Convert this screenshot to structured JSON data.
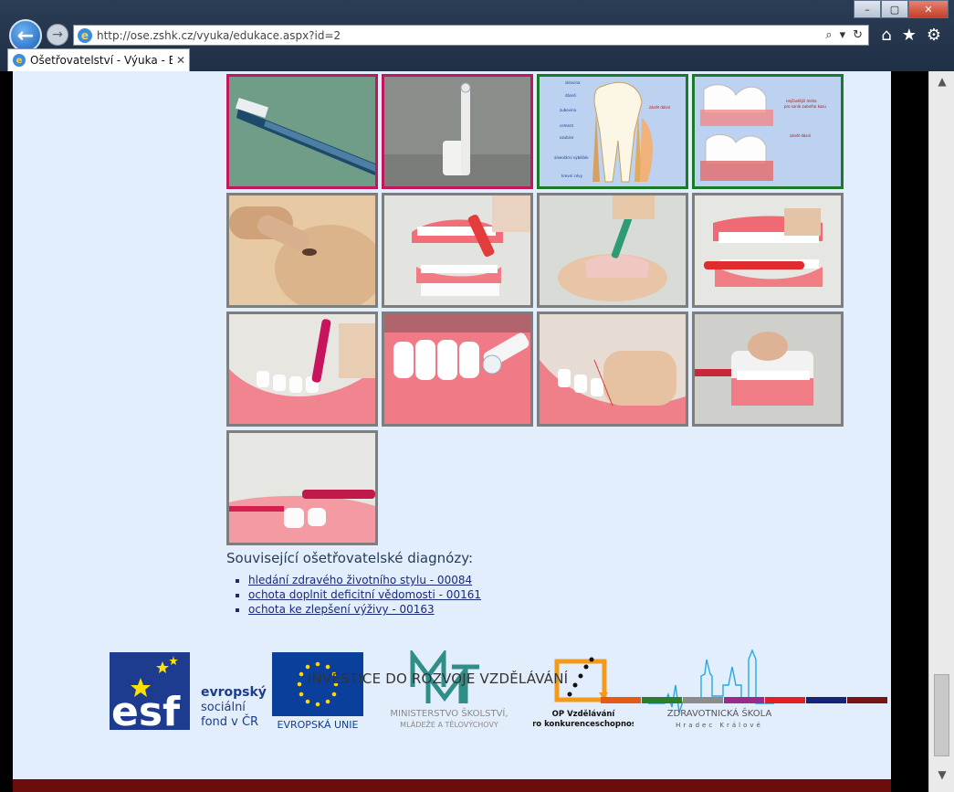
{
  "browser": {
    "url": "http://ose.zshk.cz/vyuka/edukace.aspx?id=2",
    "tab_title": "Ošetřovatelství - Výuka - Ed...",
    "tab_close": "✕",
    "back": "←",
    "forward": "→",
    "window_controls": [
      "–",
      "▢",
      "✕"
    ]
  },
  "images": [
    {
      "name": "toothbrush-photo",
      "border": "pink"
    },
    {
      "name": "electric-toothbrush-photo",
      "border": "pink"
    },
    {
      "name": "tooth-anatomy-diagram",
      "border": "green"
    },
    {
      "name": "gum-inflammation-diagram",
      "border": "green"
    },
    {
      "name": "infant-oral-care-photo",
      "border": "gray"
    },
    {
      "name": "denture-model-brushing-photo",
      "border": "gray"
    },
    {
      "name": "denture-cleaning-photo",
      "border": "gray"
    },
    {
      "name": "model-brushing-photo",
      "border": "gray"
    },
    {
      "name": "interdental-brush-photo",
      "border": "gray"
    },
    {
      "name": "electric-brush-model-photo",
      "border": "gray"
    },
    {
      "name": "flossing-model-photo",
      "border": "gray"
    },
    {
      "name": "model-top-brushing-photo",
      "border": "gray"
    },
    {
      "name": "single-tuft-brush-photo",
      "border": "gray"
    }
  ],
  "diagram_labels": {
    "tooth": [
      "sklovina",
      "dáseň",
      "zubovina",
      "cement",
      "ozubice",
      "alveolární výběžek čelisti",
      "krevní cévy a nervy",
      "zánět dásní"
    ],
    "gum": [
      "nejčastější místa pro vznik zubního kazu",
      "zánět dásní"
    ]
  },
  "diagnoses": {
    "title": "Související ošetřovatelské diagnózy:",
    "items": [
      "hledání zdravého životního stylu - 00084",
      "ochota doplnit deficitní vědomosti - 00161",
      "ochota ke zlepšení výživy - 00163"
    ]
  },
  "footer": {
    "esf_lines": [
      "evropský",
      "sociální",
      "fond v ČR"
    ],
    "esf_mark": "esf",
    "eu_label": "EVROPSKÁ UNIE",
    "msmt_lines": [
      "MINISTERSTVO ŠKOLSTVÍ,",
      "MLÁDEŽE A TĚLOVÝCHOVY"
    ],
    "op_lines": [
      "OP Vzdělávání",
      "pro konkurenceschopnost"
    ],
    "zs_lines": [
      "ZDRAVOTNICKÁ ŠKOLA",
      "Hradec Králové"
    ],
    "invest": "INVESTICE DO ROZVOJE VZDĚLÁVÁNÍ",
    "colors": [
      "#e85a13",
      "#2f7d2a",
      "#8c8c8c",
      "#9c2a8c",
      "#e31e24",
      "#16237a",
      "#7a1515"
    ]
  }
}
